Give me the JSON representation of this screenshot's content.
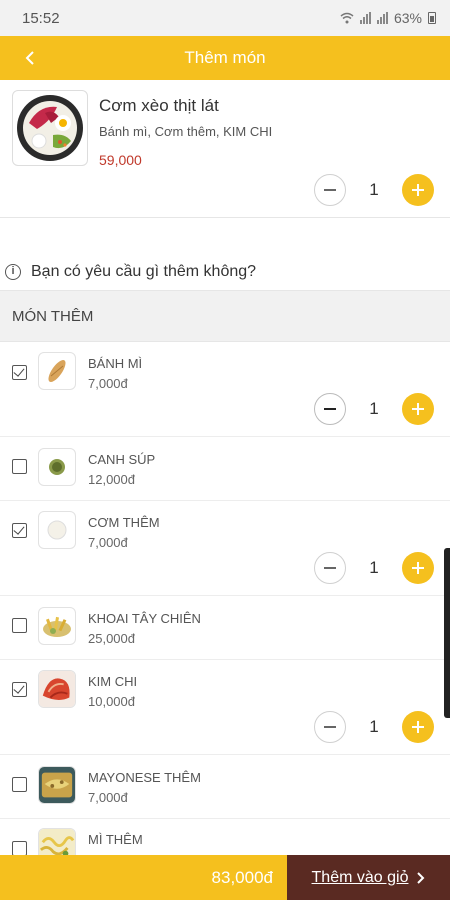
{
  "status_bar": {
    "time": "15:52",
    "battery": "63%"
  },
  "header": {
    "title": "Thêm món",
    "back_icon": "chevron-left-icon"
  },
  "product": {
    "name": "Cơm xèo thịt lát",
    "description": "Bánh mì, Cơm thêm, KIM CHI",
    "price": "59,000",
    "quantity": "1"
  },
  "request": {
    "text": "Bạn có yêu cầu gì thêm không?",
    "icon": "info-icon"
  },
  "extras_section": {
    "title": "MÓN THÊM"
  },
  "extras": [
    {
      "name": "BÁNH MÌ",
      "price": "7,000đ",
      "checked": true,
      "quantity": "1"
    },
    {
      "name": "CANH SÚP",
      "price": "12,000đ",
      "checked": false
    },
    {
      "name": "CƠM THÊM",
      "price": "7,000đ",
      "checked": true,
      "quantity": "1"
    },
    {
      "name": "KHOAI TÂY CHIÊN",
      "price": "25,000đ",
      "checked": false
    },
    {
      "name": "KIM CHI",
      "price": "10,000đ",
      "checked": true,
      "quantity": "1"
    },
    {
      "name": "MAYONESE THÊM",
      "price": "7,000đ",
      "checked": false
    },
    {
      "name": "MÌ THÊM",
      "price": "",
      "checked": false
    }
  ],
  "footer": {
    "total": "83,000đ",
    "cart_label": "Thêm vào giỏ",
    "cart_icon": "chevron-right-icon"
  },
  "colors": {
    "accent": "#f5c01e",
    "cart_button": "#5a2a22",
    "price": "#c0392b"
  }
}
